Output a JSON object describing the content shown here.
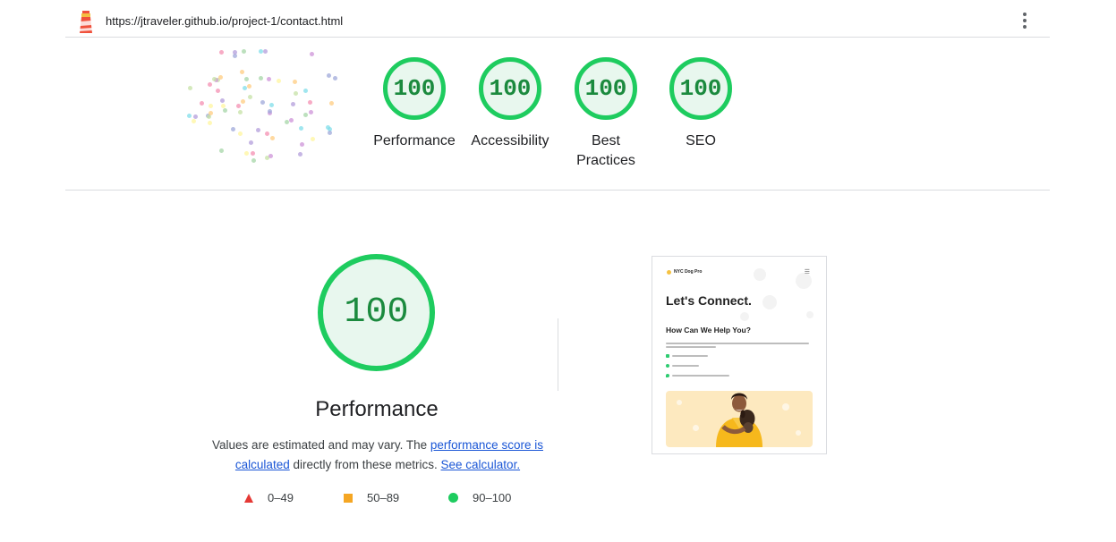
{
  "browser": {
    "url": "https://jtraveler.github.io/project-1/contact.html",
    "icons": {
      "logo": "lighthouse-icon",
      "menu": "more-vert-icon"
    }
  },
  "summary": {
    "gauges": [
      {
        "score": "100",
        "label": "Performance"
      },
      {
        "score": "100",
        "label": "Accessibility"
      },
      {
        "score": "100",
        "label": "Best Practices"
      },
      {
        "score": "100",
        "label": "SEO"
      }
    ]
  },
  "performance": {
    "score": "100",
    "title": "Performance",
    "desc_prefix": "Values are estimated and may vary. The ",
    "link_score": "performance score is calculated",
    "desc_mid": " directly from these metrics. ",
    "link_calc": "See calculator.",
    "legend": [
      {
        "range": "0–49",
        "shape": "triangle",
        "color": "#e53935"
      },
      {
        "range": "50–89",
        "shape": "square",
        "color": "#f5a623"
      },
      {
        "range": "90–100",
        "shape": "circle",
        "color": "#1ecc5f"
      }
    ]
  },
  "thumbnail": {
    "brand": "NYC Dog Pro",
    "heading": "Let's Connect.",
    "subheading": "How Can We Help You?"
  },
  "colors": {
    "pass_ring": "#1ecc5f",
    "pass_fill": "#e8f7ee",
    "pass_text": "#1b8a3e",
    "link": "#1a56d6"
  }
}
